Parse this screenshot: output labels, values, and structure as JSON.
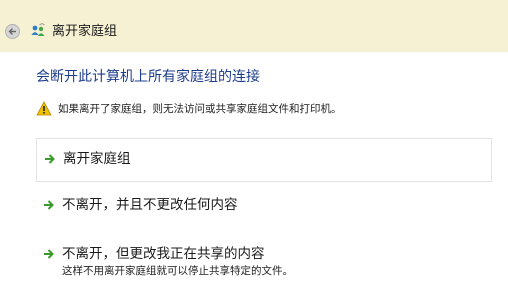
{
  "window": {
    "title": "离开家庭组",
    "back_icon": "back-arrow-icon",
    "app_icon": "homegroup-icon"
  },
  "main": {
    "headline": "会断开此计算机上所有家庭组的连接",
    "warning": {
      "icon": "warning-icon",
      "text": "如果离开了家庭组，则无法访问或共享家庭组文件和打印机。"
    },
    "options": [
      {
        "label": "离开家庭组",
        "icon": "green-arrow-icon"
      },
      {
        "label": "不离开，并且不更改任何内容",
        "icon": "green-arrow-icon"
      },
      {
        "label": "不离开，但更改我正在共享的内容",
        "description": "这样不用离开家庭组就可以停止共享特定的文件。",
        "icon": "green-arrow-icon"
      }
    ]
  },
  "colors": {
    "titlebar_bg": "#f6f1d3",
    "headline": "#1e3d8c",
    "arrow_green": "#3a9a2a",
    "warning_yellow": "#f2c200"
  }
}
